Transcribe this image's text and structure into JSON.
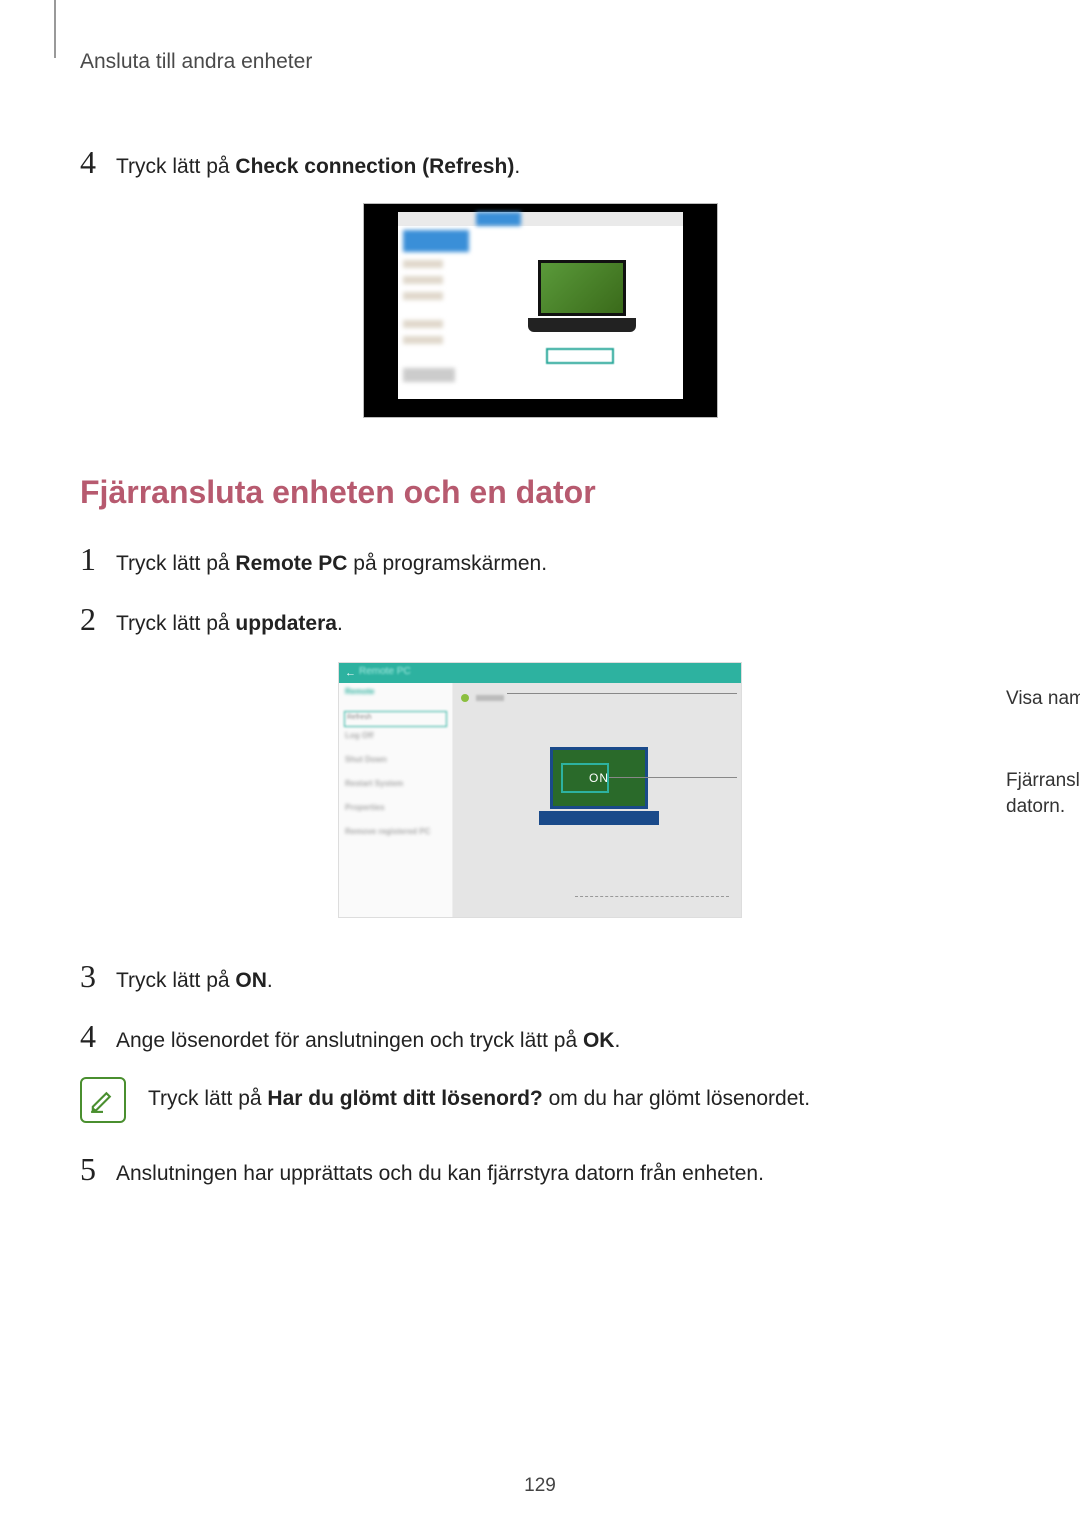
{
  "header": "Ansluta till andra enheter",
  "step_top": {
    "num": "4",
    "prefix": "Tryck lätt på ",
    "bold": "Check connection (Refresh)",
    "suffix": "."
  },
  "section_title": "Fjärransluta enheten och en dator",
  "steps": [
    {
      "num": "1",
      "prefix": "Tryck lätt på ",
      "bold": "Remote PC",
      "suffix": " på programskärmen."
    },
    {
      "num": "2",
      "prefix": "Tryck lätt på ",
      "bold": "uppdatera",
      "suffix": "."
    },
    {
      "num": "3",
      "prefix": "Tryck lätt på ",
      "bold": "ON",
      "suffix": "."
    },
    {
      "num": "4",
      "prefix": "Ange lösenordet för anslutningen och tryck lätt på ",
      "bold": "OK",
      "suffix": "."
    },
    {
      "num": "5",
      "prefix": "Anslutningen har upprättats och du kan fjärrstyra datorn från enheten.",
      "bold": "",
      "suffix": ""
    }
  ],
  "callouts": {
    "name": "Visa namnet på datorn.",
    "connect": "Fjärranslut enheten och datorn."
  },
  "note": {
    "prefix": "Tryck lätt på ",
    "bold": "Har du glömt ditt lösenord?",
    "suffix": " om du har glömt lösenordet."
  },
  "figure2": {
    "laptop_label": "ON"
  },
  "page_number": "129"
}
